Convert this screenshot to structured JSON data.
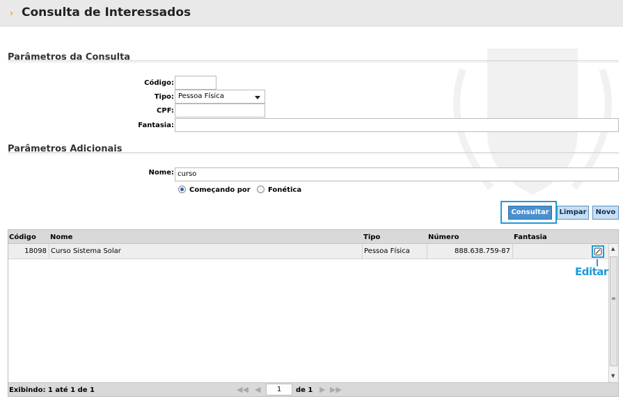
{
  "header": {
    "title": "Consulta de Interessados"
  },
  "params": {
    "section_title": "Parâmetros da Consulta",
    "codigo_label": "Código:",
    "codigo_value": "",
    "tipo_label": "Tipo:",
    "tipo_value": "Pessoa Física",
    "cpf_label": "CPF:",
    "cpf_value": "",
    "fantasia_label": "Fantasia:",
    "fantasia_value": ""
  },
  "extra": {
    "section_title": "Parâmetros Adicionais",
    "nome_label": "Nome:",
    "nome_value": "curso",
    "radio_begins": "Começando por",
    "radio_phonetic": "Fonética",
    "selected_radio": "Começando por"
  },
  "buttons": {
    "consultar": "Consultar",
    "limpar": "Limpar",
    "novo": "Novo"
  },
  "grid": {
    "columns": [
      "Código",
      "Nome",
      "Tipo",
      "Número",
      "Fantasia"
    ],
    "rows": [
      {
        "codigo": "18098",
        "nome": "Curso Sistema Solar",
        "tipo": "Pessoa Física",
        "numero": "888.638.759-87",
        "fantasia": ""
      }
    ],
    "footer_info": "Exibindo: 1 até 1 de 1",
    "page_number": "1",
    "page_of": "de 1"
  },
  "annotation": {
    "edit_label": "Editar"
  },
  "colors": {
    "accent": "#1e9ad6",
    "button": "#4a90cf",
    "header_bg": "#e9e9e9"
  },
  "icons": [
    "chevron-right-icon",
    "edit-icon",
    "first-page-icon",
    "prev-page-icon",
    "next-page-icon",
    "last-page-icon"
  ]
}
